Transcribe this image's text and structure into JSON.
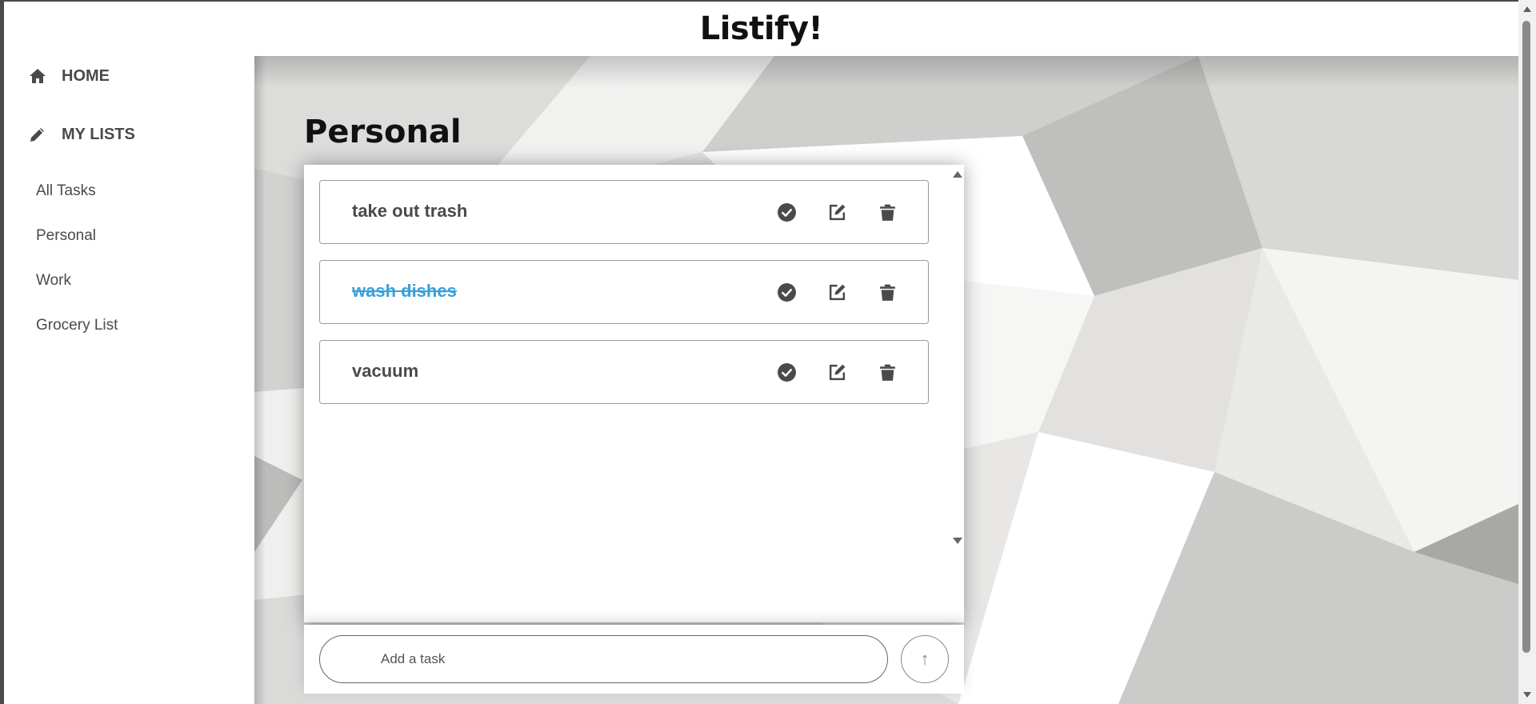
{
  "app": {
    "title": "Listify!"
  },
  "sidebar": {
    "home_label": "HOME",
    "home_icon": "home-icon",
    "my_lists_label": "MY LISTS",
    "my_lists_icon": "pencil-icon",
    "lists": [
      {
        "label": "All Tasks"
      },
      {
        "label": "Personal"
      },
      {
        "label": "Work"
      },
      {
        "label": "Grocery List"
      }
    ]
  },
  "main": {
    "list_title": "Personal",
    "tasks": [
      {
        "text": "take out trash",
        "completed": false
      },
      {
        "text": "wash dishes",
        "completed": true
      },
      {
        "text": "vacuum",
        "completed": false
      }
    ],
    "task_actions": [
      "check-circle-icon",
      "edit-icon",
      "trash-icon"
    ],
    "input": {
      "value": "",
      "placeholder": "Add a task"
    },
    "submit_label": "↑"
  },
  "colors": {
    "text_dark": "#4a4a4a",
    "completed_task": "#3aa0d8",
    "border": "#9a9a9a"
  }
}
